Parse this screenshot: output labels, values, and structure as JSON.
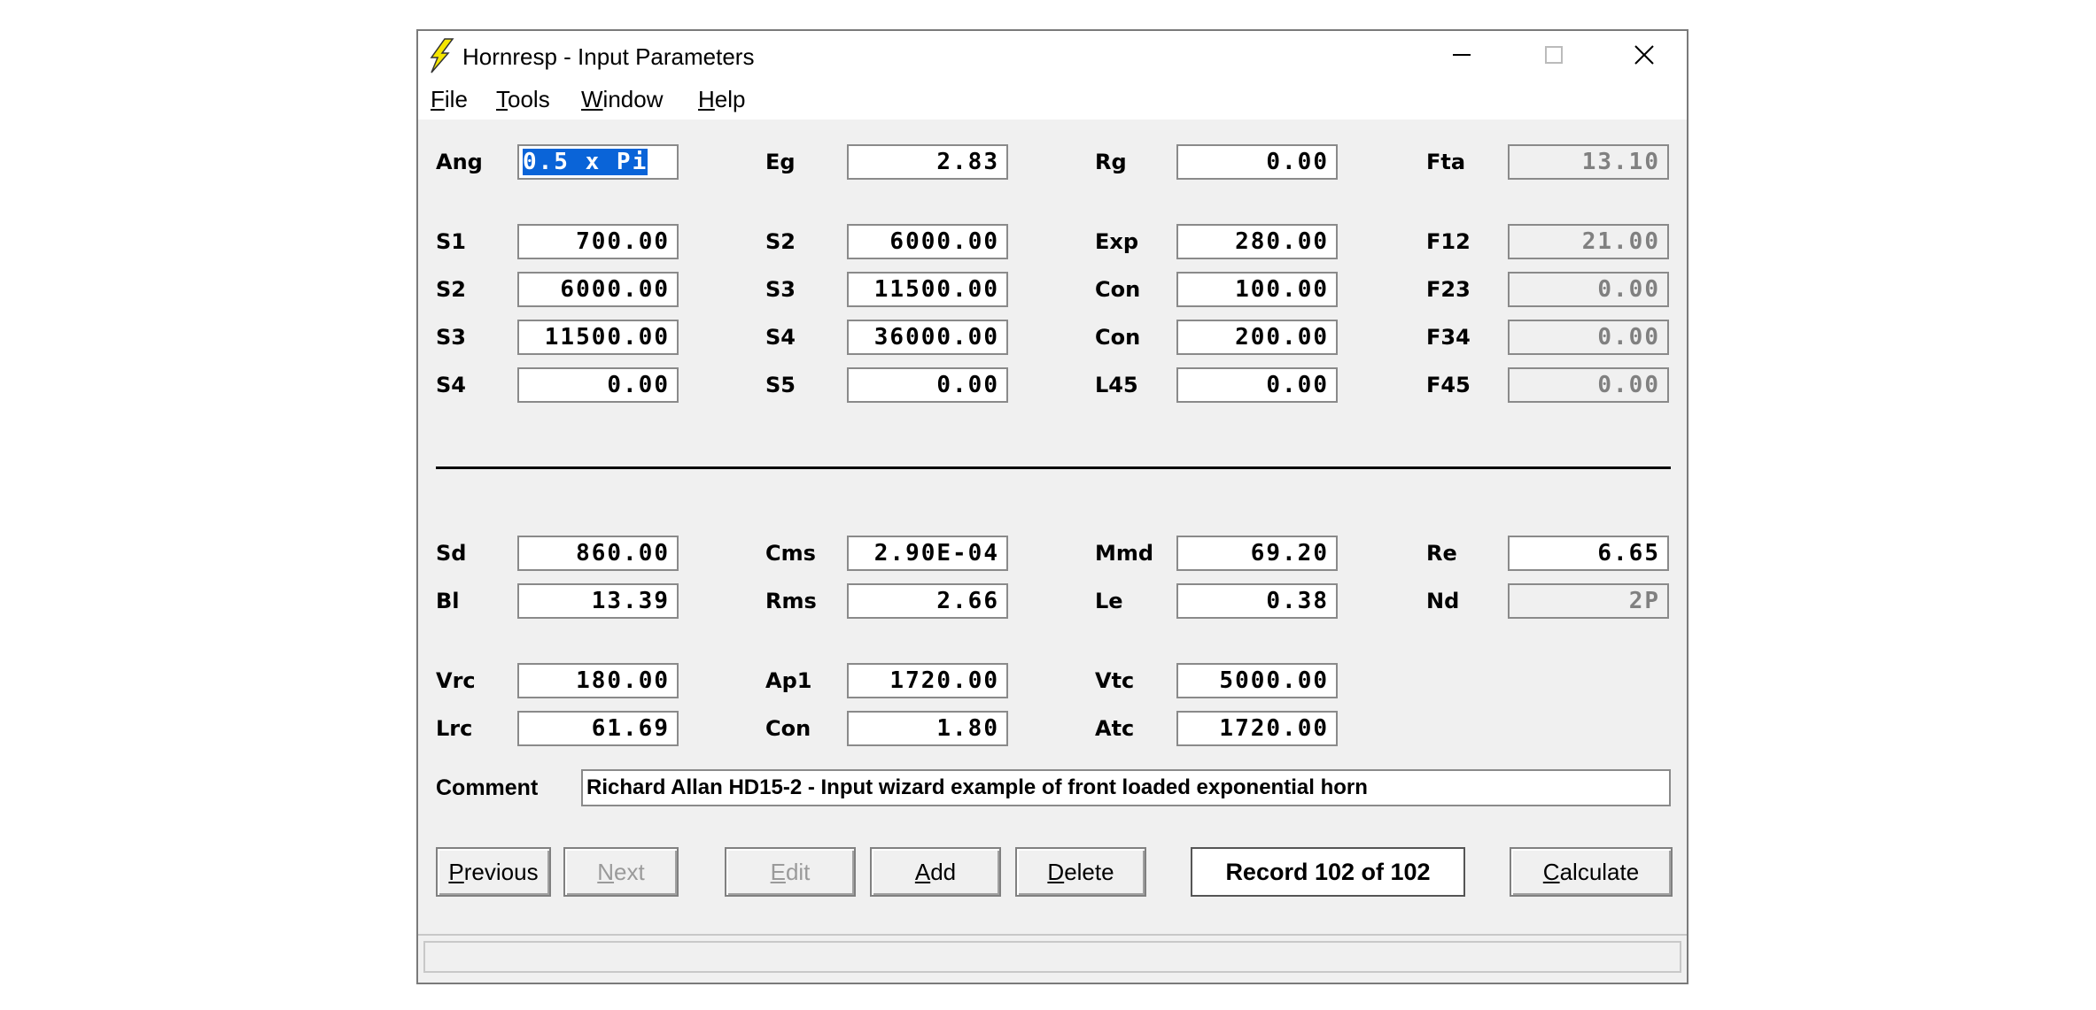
{
  "window": {
    "title": "Hornresp - Input Parameters"
  },
  "menu": [
    {
      "label": "File",
      "accel": "F",
      "rest": "ile"
    },
    {
      "label": "Tools",
      "accel": "T",
      "rest": "ools"
    },
    {
      "label": "Window",
      "accel": "W",
      "rest": "indow"
    },
    {
      "label": "Help",
      "accel": "H",
      "rest": "elp"
    }
  ],
  "params": {
    "ang": {
      "label": "Ang",
      "value": "0.5 x Pi"
    },
    "eg": {
      "label": "Eg",
      "value": "2.83"
    },
    "rg": {
      "label": "Rg",
      "value": "0.00"
    },
    "fta": {
      "label": "Fta",
      "value": "13.10"
    },
    "s1_a": {
      "label": "S1",
      "value": "700.00"
    },
    "s2_b": {
      "label": "S2",
      "value": "6000.00"
    },
    "exp": {
      "label": "Exp",
      "value": "280.00"
    },
    "f12": {
      "label": "F12",
      "value": "21.00"
    },
    "s2_a": {
      "label": "S2",
      "value": "6000.00"
    },
    "s3_b": {
      "label": "S3",
      "value": "11500.00"
    },
    "con1": {
      "label": "Con",
      "value": "100.00"
    },
    "f23": {
      "label": "F23",
      "value": "0.00"
    },
    "s3_a": {
      "label": "S3",
      "value": "11500.00"
    },
    "s4_b": {
      "label": "S4",
      "value": "36000.00"
    },
    "con2": {
      "label": "Con",
      "value": "200.00"
    },
    "f34": {
      "label": "F34",
      "value": "0.00"
    },
    "s4_a": {
      "label": "S4",
      "value": "0.00"
    },
    "s5_b": {
      "label": "S5",
      "value": "0.00"
    },
    "l45": {
      "label": "L45",
      "value": "0.00"
    },
    "f45": {
      "label": "F45",
      "value": "0.00"
    },
    "sd": {
      "label": "Sd",
      "value": "860.00"
    },
    "cms": {
      "label": "Cms",
      "value": "2.90E-04"
    },
    "mmd": {
      "label": "Mmd",
      "value": "69.20"
    },
    "re": {
      "label": "Re",
      "value": "6.65"
    },
    "bl": {
      "label": "Bl",
      "value": "13.39"
    },
    "rms": {
      "label": "Rms",
      "value": "2.66"
    },
    "le": {
      "label": "Le",
      "value": "0.38"
    },
    "nd": {
      "label": "Nd",
      "value": "2P"
    },
    "vrc": {
      "label": "Vrc",
      "value": "180.00"
    },
    "ap1": {
      "label": "Ap1",
      "value": "1720.00"
    },
    "vtc": {
      "label": "Vtc",
      "value": "5000.00"
    },
    "lrc": {
      "label": "Lrc",
      "value": "61.69"
    },
    "con3": {
      "label": "Con",
      "value": "1.80"
    },
    "atc": {
      "label": "Atc",
      "value": "1720.00"
    }
  },
  "comment": {
    "label": "Comment",
    "value": "Richard Allan HD15-2 - Input wizard example of front loaded exponential horn"
  },
  "buttons": {
    "previous": {
      "accel": "P",
      "rest": "revious"
    },
    "next": {
      "accel": "N",
      "rest": "ext"
    },
    "edit": {
      "accel": "E",
      "rest": "dit"
    },
    "add": {
      "accel": "A",
      "rest": "dd"
    },
    "delete": {
      "accel": "D",
      "rest": "elete"
    },
    "calculate": {
      "accel": "C",
      "rest": "alculate"
    }
  },
  "record": "Record 102 of 102"
}
